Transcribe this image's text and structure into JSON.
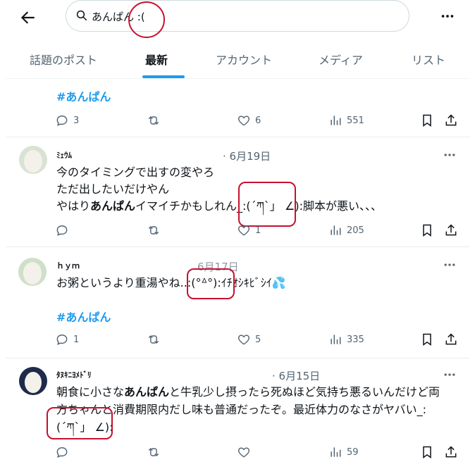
{
  "search": {
    "value": "あんぱん :("
  },
  "tabs": [
    {
      "label": "話題のポスト"
    },
    {
      "label": "最新"
    },
    {
      "label": "アカウント"
    },
    {
      "label": "メディア"
    },
    {
      "label": "リスト"
    }
  ],
  "post0": {
    "hashtag": "#あんぱん",
    "replies": "3",
    "likes": "6",
    "views": "551"
  },
  "post1": {
    "username": "ﾐｪｳﾑ",
    "date": "· 6月19日",
    "line1": "今のタイミングで出すの変やろ",
    "line2": "ただ出したいだけやん",
    "line3_pre": "やはり",
    "line3_bold": "あんぱん",
    "line3_post": "イマイチかもしれん_:(´ཀ`」 ∠):脚本が悪い、、、",
    "likes": "1",
    "views": "205"
  },
  "post2": {
    "username": "ｈｙｍ",
    "date": "6月17日",
    "text": "お粥というより重湯やね..:(°ᐞ°):ｲﾁｵｼｷﾋﾞｼｲ",
    "emoji": "💦",
    "hashtag": "#あんぱん",
    "replies": "1",
    "likes": "5",
    "views": "335"
  },
  "post3": {
    "username": "ﾀﾇｷﾆﾖﾒﾄﾞﾘ",
    "date": "· 6月15日",
    "line1_pre": "朝食に小さな",
    "line1_bold": "あんぱん",
    "line1_post": "と牛乳少し摂ったら死ぬほど気持ち悪るいんだけど両",
    "line2": "方ちゃんと消費期限内だし味も普通だったぞ。最近体力のなさがヤバい_:",
    "line3": "(´ཀ`」 ∠):",
    "views": "59"
  },
  "colors": {
    "accent": "#1d9bf0",
    "annotation": "#c8102e",
    "muted": "#536471"
  }
}
